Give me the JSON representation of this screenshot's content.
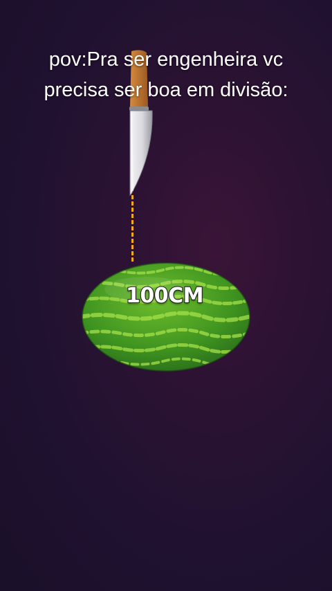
{
  "caption": {
    "line1": "pov:Pra ser engenheira vc",
    "line2": "precisa ser boa em divisão:"
  },
  "watermelon": {
    "label": "100CM"
  },
  "icons": {
    "knife": "knife-icon",
    "watermelon": "watermelon-icon"
  },
  "colors": {
    "background": "#24112e",
    "guide_line": "#f2a91c",
    "watermelon_dark": "#2e7d1c",
    "watermelon_light": "#7fcf3a"
  }
}
